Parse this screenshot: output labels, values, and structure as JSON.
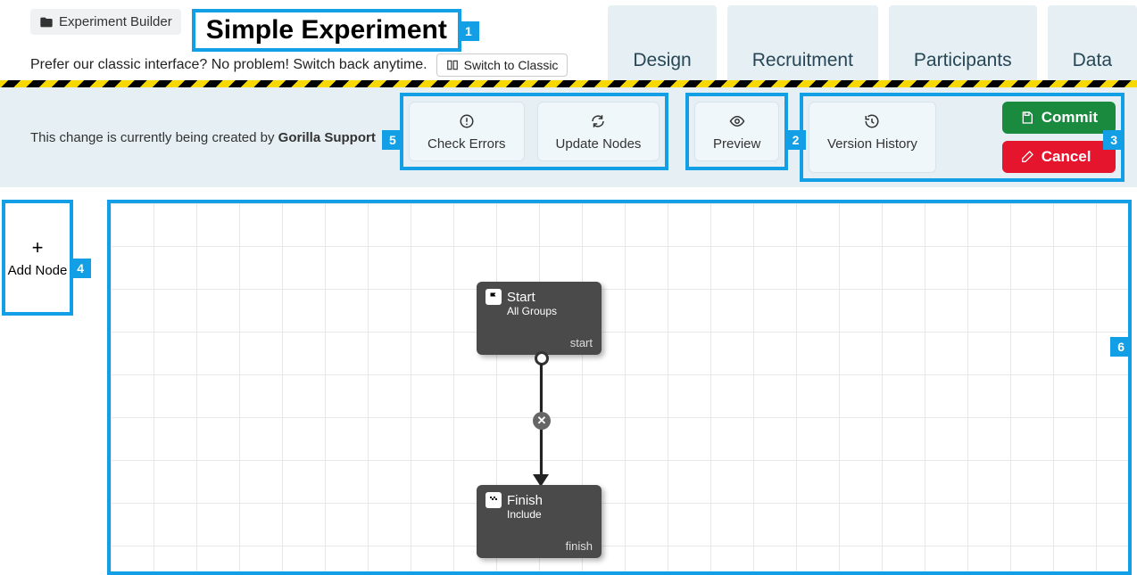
{
  "header": {
    "builder_label": "Experiment Builder",
    "title": "Simple Experiment",
    "prefer_text": "Prefer our classic interface? No problem! Switch back anytime.",
    "switch_label": "Switch to Classic"
  },
  "tabs": {
    "design": "Design",
    "recruitment": "Recruitment",
    "participants": "Participants",
    "data": "Data"
  },
  "toolbar": {
    "change_prefix": "This change is currently being created by ",
    "change_author": "Gorilla Support",
    "check_errors": "Check Errors",
    "update_nodes": "Update Nodes",
    "preview": "Preview",
    "version_history": "Version History",
    "commit": "Commit",
    "cancel": "Cancel"
  },
  "sidebar": {
    "add_node": "Add Node"
  },
  "nodes": {
    "start": {
      "title": "Start",
      "sub": "All Groups",
      "foot": "start"
    },
    "finish": {
      "title": "Finish",
      "sub": "Include",
      "foot": "finish"
    }
  },
  "callouts": {
    "b1": "1",
    "b2": "2",
    "b3": "3",
    "b4": "4",
    "b5": "5",
    "b6": "6"
  }
}
